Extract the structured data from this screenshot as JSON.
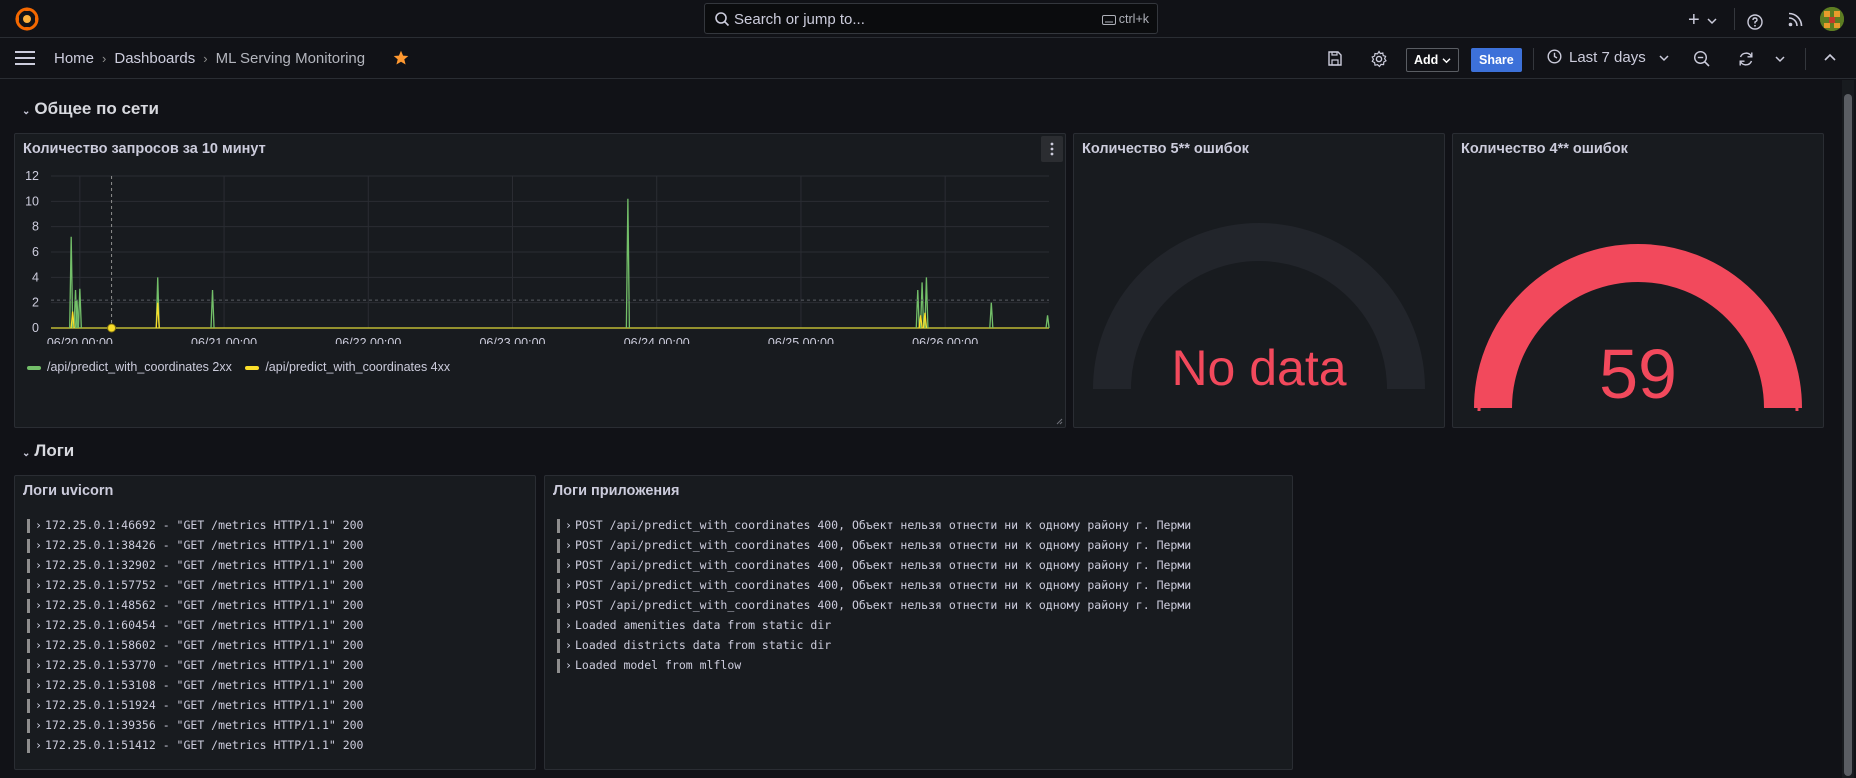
{
  "topbar": {
    "search_placeholder": "Search or jump to...",
    "search_shortcut": "ctrl+k",
    "plus_label": "+"
  },
  "nav": {
    "breadcrumbs": [
      "Home",
      "Dashboards",
      "ML Serving Monitoring"
    ],
    "add_label": "Add",
    "share_label": "Share",
    "time_range": "Last 7 days"
  },
  "rows": [
    {
      "title": "Общее по сети"
    },
    {
      "title": "Логи"
    }
  ],
  "panels": {
    "requests": {
      "title": "Количество запросов за 10 минут"
    },
    "errors5xx": {
      "title": "Количество 5** ошибок",
      "value": "No data"
    },
    "errors4xx": {
      "title": "Количество 4** ошибок",
      "value": "59"
    },
    "uvicorn": {
      "title": "Логи uvicorn",
      "lines": [
        "172.25.0.1:46692 - \"GET /metrics HTTP/1.1\" 200",
        "172.25.0.1:38426 - \"GET /metrics HTTP/1.1\" 200",
        "172.25.0.1:32902 - \"GET /metrics HTTP/1.1\" 200",
        "172.25.0.1:57752 - \"GET /metrics HTTP/1.1\" 200",
        "172.25.0.1:48562 - \"GET /metrics HTTP/1.1\" 200",
        "172.25.0.1:60454 - \"GET /metrics HTTP/1.1\" 200",
        "172.25.0.1:58602 - \"GET /metrics HTTP/1.1\" 200",
        "172.25.0.1:53770 - \"GET /metrics HTTP/1.1\" 200",
        "172.25.0.1:53108 - \"GET /metrics HTTP/1.1\" 200",
        "172.25.0.1:51924 - \"GET /metrics HTTP/1.1\" 200",
        "172.25.0.1:39356 - \"GET /metrics HTTP/1.1\" 200",
        "172.25.0.1:51412 - \"GET /metrics HTTP/1.1\" 200"
      ]
    },
    "app": {
      "title": "Логи приложения",
      "lines": [
        "POST /api/predict_with_coordinates 400, Объект нельзя отнести ни к одному району г. Перми",
        "POST /api/predict_with_coordinates 400, Объект нельзя отнести ни к одному району г. Перми",
        "POST /api/predict_with_coordinates 400, Объект нельзя отнести ни к одному району г. Перми",
        "POST /api/predict_with_coordinates 400, Объект нельзя отнести ни к одному району г. Перми",
        "POST /api/predict_with_coordinates 400, Объект нельзя отнести ни к одному району г. Перми",
        "Loaded amenities data from static dir",
        "Loaded districts data from static dir",
        "Loaded model from mlflow"
      ]
    }
  },
  "colors": {
    "green": "#73bf69",
    "yellow": "#fade2a",
    "red": "#f2495c",
    "blue": "#3d71d9"
  },
  "chart_data": {
    "type": "line",
    "title": "Количество запросов за 10 минут",
    "ylim": [
      0,
      12
    ],
    "y_ticks": [
      "0",
      "2",
      "4",
      "6",
      "8",
      "10",
      "12"
    ],
    "x_ticks": [
      "06/20 00:00",
      "06/21 00:00",
      "06/22 00:00",
      "06/23 00:00",
      "06/24 00:00",
      "06/25 00:00",
      "06/26 00:00"
    ],
    "grid": true,
    "legend_placement": "bottom-left",
    "x_unit_note": "days",
    "xlim": [
      -0.2,
      6.72
    ],
    "series": [
      {
        "name": "/api/predict_with_coordinates 2xx",
        "color": "#73bf69",
        "spikes": [
          [
            -0.06,
            7.2
          ],
          [
            -0.03,
            3.0
          ],
          [
            -0.02,
            2.2
          ],
          [
            0.0,
            3.1
          ],
          [
            0.54,
            4.0
          ],
          [
            0.92,
            3.0
          ],
          [
            3.8,
            10.2
          ],
          [
            5.81,
            3.0
          ],
          [
            5.84,
            3.6
          ],
          [
            5.87,
            4.0
          ],
          [
            6.32,
            2.0
          ],
          [
            6.71,
            1.0
          ]
        ]
      },
      {
        "name": "/api/predict_with_coordinates 4xx",
        "color": "#fade2a",
        "spikes": [
          [
            -0.05,
            1.3
          ],
          [
            0.54,
            2.0
          ],
          [
            5.83,
            1.0
          ],
          [
            5.86,
            1.2
          ]
        ]
      }
    ]
  }
}
